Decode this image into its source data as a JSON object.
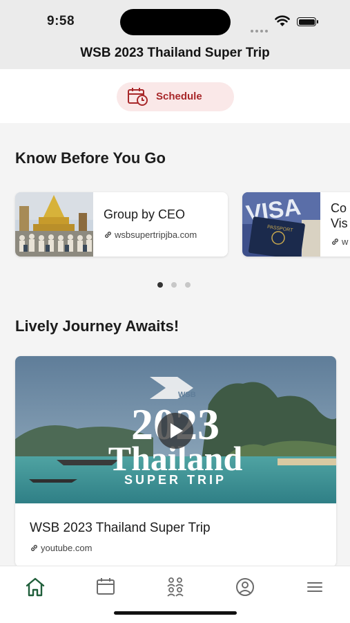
{
  "status_bar": {
    "time": "9:58"
  },
  "header": {
    "title": "WSB 2023 Thailand Super Trip"
  },
  "schedule": {
    "label": "Schedule",
    "accent": "#a8282a",
    "bg": "#fae8e8"
  },
  "know_before": {
    "heading": "Know Before You Go",
    "cards": [
      {
        "title": "Group by CEO",
        "link": "wsbsupertripjba.com",
        "image": "temple-group-photo"
      },
      {
        "title": "Co Vis",
        "title_line1": "Co",
        "title_line2": "Vis",
        "link": "w",
        "image": "passport-visa-photo"
      }
    ],
    "page_dots": 3,
    "active_dot": 0
  },
  "journey": {
    "heading": "Lively Journey Awaits!",
    "video": {
      "overlay_year": "2023",
      "overlay_title": "Thailand",
      "overlay_sub": "SUPER TRIP",
      "overlay_logo": "WSB",
      "title": "WSB 2023 Thailand Super Trip",
      "link": "youtube.com"
    }
  },
  "tabs": [
    {
      "name": "home",
      "icon": "home-icon",
      "active": true
    },
    {
      "name": "schedule",
      "icon": "calendar-icon"
    },
    {
      "name": "people",
      "icon": "people-icon"
    },
    {
      "name": "profile",
      "icon": "profile-icon"
    },
    {
      "name": "menu",
      "icon": "menu-icon"
    }
  ],
  "colors": {
    "active_tab": "#1f5e3a",
    "inactive_tab": "#6b6b6b"
  }
}
